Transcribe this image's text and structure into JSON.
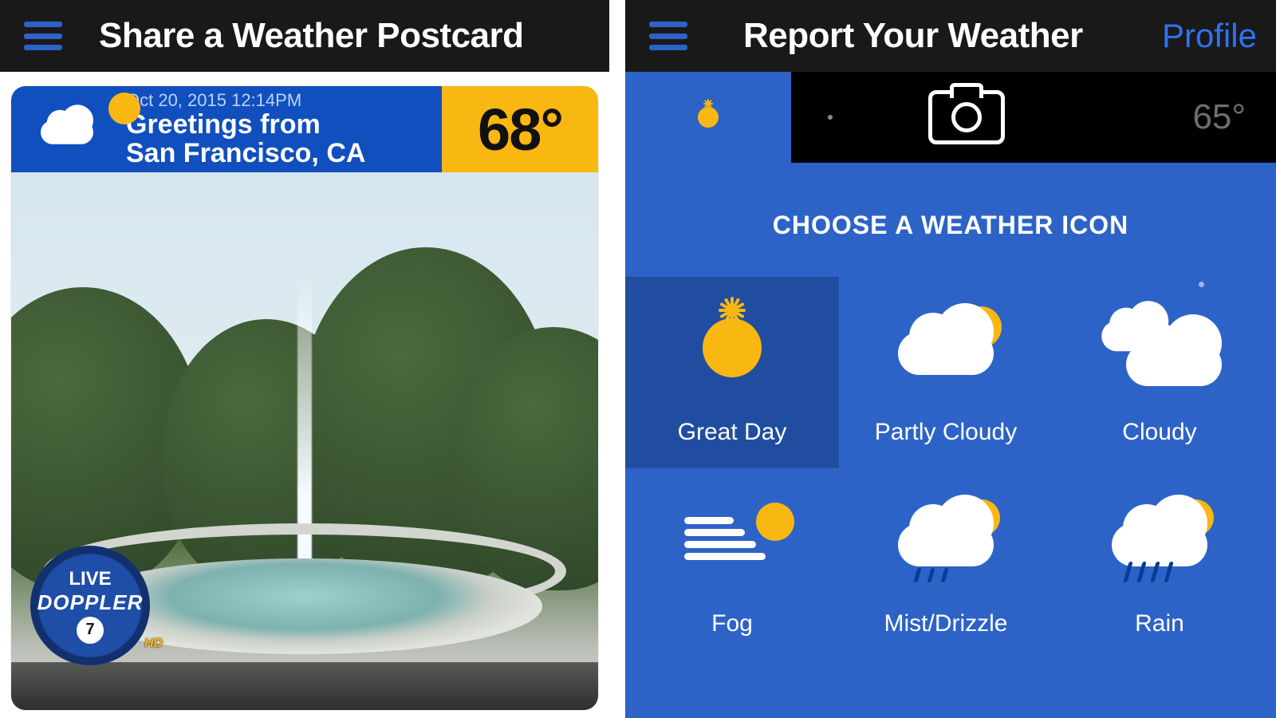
{
  "left": {
    "title": "Share a Weather Postcard",
    "postcard": {
      "datetime": "Oct 20, 2015   12:14PM",
      "greeting_line1": "Greetings from",
      "greeting_line2": "San Francisco, CA",
      "temperature": "68°",
      "badge": {
        "line1": "LIVE",
        "line2": "DOPPLER",
        "channel": "7",
        "hd": "HD"
      }
    }
  },
  "right": {
    "title": "Report Your Weather",
    "profile": "Profile",
    "top_temp": "65°",
    "section_title": "CHOOSE A WEATHER ICON",
    "tiles": [
      {
        "id": "great-day",
        "label": "Great Day",
        "selected": true
      },
      {
        "id": "partly-cloudy",
        "label": "Partly Cloudy",
        "selected": false
      },
      {
        "id": "cloudy",
        "label": "Cloudy",
        "selected": false
      },
      {
        "id": "fog",
        "label": "Fog",
        "selected": false
      },
      {
        "id": "mist-drizzle",
        "label": "Mist/Drizzle",
        "selected": false
      },
      {
        "id": "rain",
        "label": "Rain",
        "selected": false
      }
    ]
  },
  "colors": {
    "brand_blue": "#114FBF",
    "panel_blue": "#2D63C7",
    "select_blue": "#204D9F",
    "amber": "#F9B712",
    "link": "#3071F2"
  }
}
